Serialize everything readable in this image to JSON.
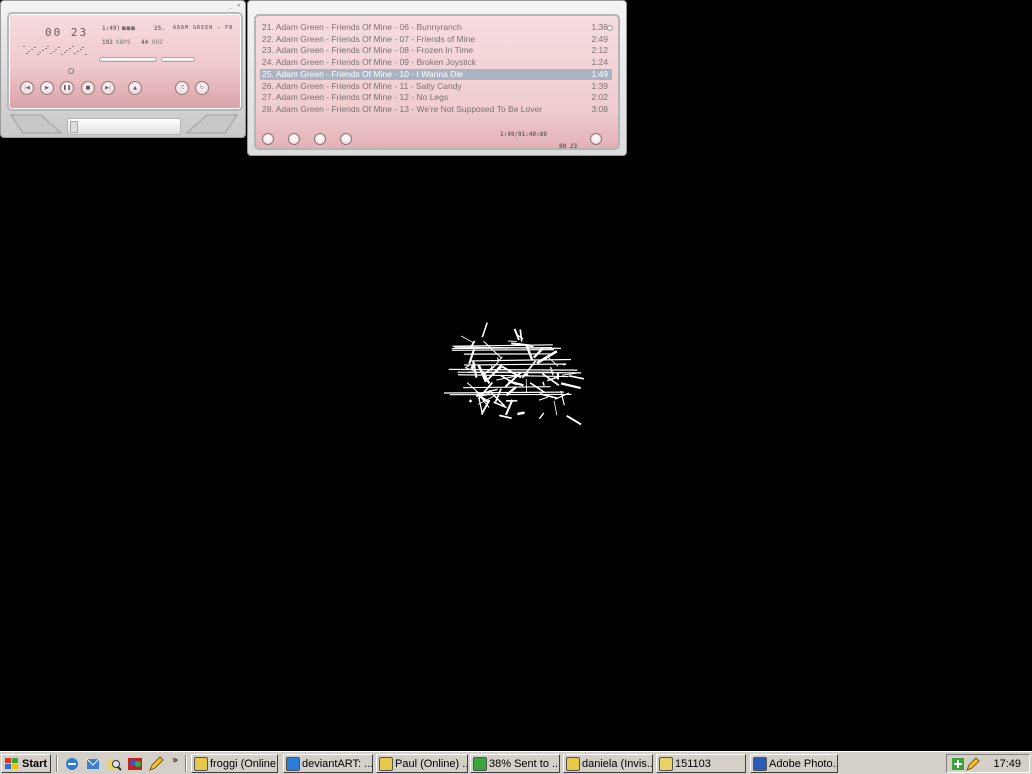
{
  "player": {
    "time": "00 23",
    "track_length": "1:49)",
    "track_info": "25.",
    "scroll_title": "ADAM GREEN - FR",
    "bitrate": "192",
    "bitrate_unit": "KBPS",
    "samplerate": "44",
    "samplerate_unit": "KHZ",
    "controls": [
      "prev",
      "play",
      "pause",
      "stop",
      "next",
      "eject",
      "shuffle",
      "repeat"
    ]
  },
  "playlist": {
    "items": [
      {
        "title": "21. Adam Green - Friends Of Mine - 06 - Bunnyranch",
        "duration": "1:36"
      },
      {
        "title": "22. Adam Green - Friends Of Mine - 07 - Friends of Mine",
        "duration": "2:49"
      },
      {
        "title": "23. Adam Green - Friends Of Mine - 08 - Frozen In Time",
        "duration": "2:12"
      },
      {
        "title": "24. Adam Green - Friends Of Mine - 09 - Broken Joystick",
        "duration": "1:24"
      },
      {
        "title": "25. Adam Green - Friends Of Mine - 10 - I Wanna Die",
        "duration": "1:49",
        "selected": true
      },
      {
        "title": "26. Adam Green - Friends Of Mine - 11 - Salty Candy",
        "duration": "1:39"
      },
      {
        "title": "27. Adam Green - Friends Of Mine - 12 - No Legs",
        "duration": "2:02"
      },
      {
        "title": "28. Adam Green - Friends Of Mine - 13 - We're Not Supposed To Be Lover",
        "duration": "3:08"
      }
    ],
    "total_time": "1:49/91:40:08",
    "mini_time": "00 23"
  },
  "taskbar": {
    "start_label": "Start",
    "chevron": "»",
    "tasks": [
      {
        "label": "froggi (Online...",
        "icon": "messenger-icon"
      },
      {
        "label": "deviantART: ...",
        "icon": "internet-explorer-icon"
      },
      {
        "label": "Paul (Online) ...",
        "icon": "messenger-icon"
      },
      {
        "label": "38% Sent to ...",
        "icon": "file-transfer-icon"
      },
      {
        "label": "daniela (Invis...",
        "icon": "messenger-icon"
      },
      {
        "label": "151103",
        "icon": "search-folder-icon"
      },
      {
        "label": "Adobe Photo...",
        "icon": "photoshop-icon"
      }
    ],
    "clock": "17:49"
  },
  "colors": {
    "desktop": "#000000",
    "skin_pink": "#efc9cd",
    "selection": "#aab3c4",
    "taskbar": "#d4d0c8"
  }
}
